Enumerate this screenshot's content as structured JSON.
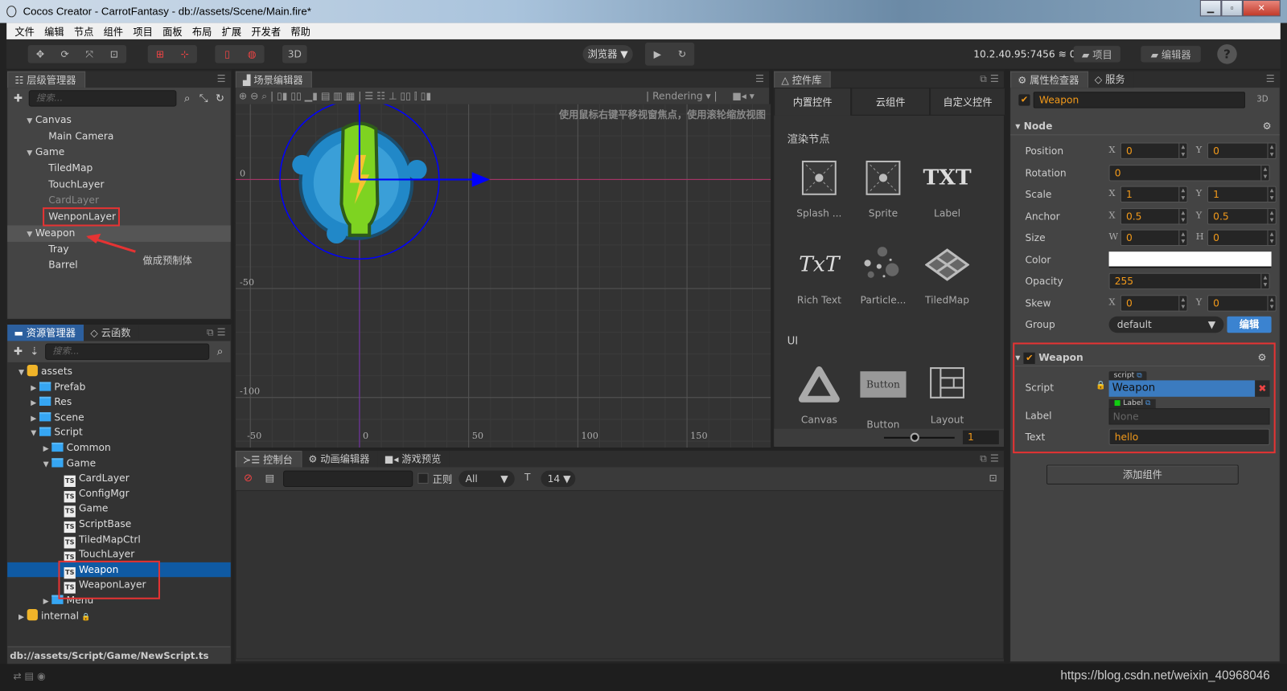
{
  "window": {
    "title": "Cocos Creator - CarrotFantasy - db://assets/Scene/Main.fire*",
    "controls": [
      "minimize",
      "maximize",
      "close"
    ]
  },
  "menu": [
    "文件",
    "编辑",
    "节点",
    "组件",
    "项目",
    "面板",
    "布局",
    "扩展",
    "开发者",
    "帮助"
  ],
  "toolbar": {
    "mode_3d": "3D",
    "preview_target": "浏览器 ▼",
    "ip": "10.2.40.95:7456",
    "devices": "0",
    "project_btn": "项目",
    "editor_btn": "编辑器",
    "help": "?"
  },
  "hierarchy": {
    "tab": "层级管理器",
    "search_placeholder": "搜索...",
    "nodes": [
      {
        "label": "Canvas",
        "depth": 0,
        "expanded": true
      },
      {
        "label": "Main Camera",
        "depth": 1
      },
      {
        "label": "Game",
        "depth": 0,
        "expanded": true
      },
      {
        "label": "TiledMap",
        "depth": 1
      },
      {
        "label": "TouchLayer",
        "depth": 1
      },
      {
        "label": "CardLayer",
        "depth": 1,
        "disabled": true
      },
      {
        "label": "WenponLayer",
        "depth": 1,
        "highlighted": true
      },
      {
        "label": "Weapon",
        "depth": 0,
        "expanded": true,
        "selected": true
      },
      {
        "label": "Tray",
        "depth": 1
      },
      {
        "label": "Barrel",
        "depth": 1
      }
    ],
    "annotation": "做成预制体",
    "annotation_color": "#e020e0"
  },
  "assets": {
    "tabs": [
      "资源管理器",
      "云函数"
    ],
    "search_placeholder": "搜索...",
    "items": [
      {
        "label": "assets",
        "depth": 0,
        "type": "db",
        "expanded": true
      },
      {
        "label": "Prefab",
        "depth": 1,
        "type": "folder"
      },
      {
        "label": "Res",
        "depth": 1,
        "type": "folder"
      },
      {
        "label": "Scene",
        "depth": 1,
        "type": "folder"
      },
      {
        "label": "Script",
        "depth": 1,
        "type": "folder",
        "expanded": true
      },
      {
        "label": "Common",
        "depth": 2,
        "type": "folder"
      },
      {
        "label": "Game",
        "depth": 2,
        "type": "folder",
        "expanded": true
      },
      {
        "label": "CardLayer",
        "depth": 3,
        "type": "ts"
      },
      {
        "label": "ConfigMgr",
        "depth": 3,
        "type": "ts"
      },
      {
        "label": "Game",
        "depth": 3,
        "type": "ts"
      },
      {
        "label": "ScriptBase",
        "depth": 3,
        "type": "ts"
      },
      {
        "label": "TiledMapCtrl",
        "depth": 3,
        "type": "ts"
      },
      {
        "label": "TouchLayer",
        "depth": 3,
        "type": "ts"
      },
      {
        "label": "Weapon",
        "depth": 3,
        "type": "ts",
        "selected": true
      },
      {
        "label": "WeaponLayer",
        "depth": 3,
        "type": "ts"
      },
      {
        "label": "Menu",
        "depth": 2,
        "type": "folder"
      },
      {
        "label": "internal",
        "depth": 0,
        "type": "db",
        "locked": true
      }
    ],
    "status_path": "db://assets/Script/Game/NewScript.ts"
  },
  "scene": {
    "tab": "场景编辑器",
    "rendering": "Rendering",
    "hint": "使用鼠标右键平移视窗焦点，使用滚轮缩放视图",
    "y_labels": [
      "0",
      "-50",
      "-100"
    ],
    "x_labels": [
      "-50",
      "0",
      "50",
      "100",
      "150"
    ]
  },
  "library": {
    "tab": "控件库",
    "subtabs": [
      "内置控件",
      "云组件",
      "自定义控件"
    ],
    "sections": [
      {
        "title": "渲染节点",
        "items": [
          "Splash ...",
          "Sprite",
          "Label",
          "Rich Text",
          "Particle...",
          "TiledMap"
        ]
      },
      {
        "title": "UI",
        "items": [
          "Canvas",
          "Button",
          "Layout"
        ]
      }
    ],
    "button_icon_text": "Button",
    "icon_txt": "TXT",
    "icon_rich": "TxT",
    "zoom_value": "1"
  },
  "console": {
    "tabs": [
      "控制台",
      "动画编辑器",
      "游戏预览"
    ],
    "regex_label": "正则",
    "level": "All",
    "font_size": "14"
  },
  "inspector": {
    "tabs": [
      "属性检查器",
      "服务"
    ],
    "node_name": "Weapon",
    "badge_3d": "3D",
    "node_section": "Node",
    "props": {
      "position": {
        "label": "Position",
        "x": "0",
        "y": "0"
      },
      "rotation": {
        "label": "Rotation",
        "value": "0"
      },
      "scale": {
        "label": "Scale",
        "x": "1",
        "y": "1"
      },
      "anchor": {
        "label": "Anchor",
        "x": "0.5",
        "y": "0.5"
      },
      "size": {
        "label": "Size",
        "w": "0",
        "h": "0"
      },
      "color": {
        "label": "Color",
        "value": "#ffffff"
      },
      "opacity": {
        "label": "Opacity",
        "value": "255"
      },
      "skew": {
        "label": "Skew",
        "x": "0",
        "y": "0"
      },
      "group": {
        "label": "Group",
        "value": "default",
        "edit": "编辑"
      }
    },
    "component": {
      "title": "Weapon",
      "script": {
        "label": "Script",
        "tag": "script",
        "value": "Weapon"
      },
      "label_prop": {
        "label": "Label",
        "tag": "Label",
        "value": "None"
      },
      "text": {
        "label": "Text",
        "value": "hello"
      }
    },
    "add_component": "添加组件"
  },
  "watermark": "https://blog.csdn.net/weixin_40968046",
  "colors": {
    "accent": "#f39a1a",
    "selection": "#0f5aa3",
    "highlight_box": "#e53333"
  }
}
